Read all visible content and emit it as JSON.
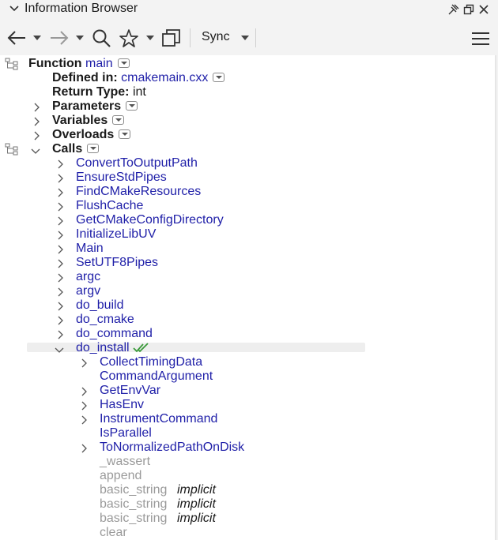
{
  "panel": {
    "title": "Information Browser"
  },
  "toolbar": {
    "sync_label": "Sync"
  },
  "tree": {
    "function_keyword": "Function",
    "function_name": "main",
    "defined_in_label": "Defined in:",
    "defined_in_file": "cmakemain.cxx",
    "return_type_label": "Return Type:",
    "return_type_value": "int",
    "parameters": "Parameters",
    "variables": "Variables",
    "overloads": "Overloads",
    "calls": "Calls",
    "call_items": [
      "ConvertToOutputPath",
      "EnsureStdPipes",
      "FindCMakeResources",
      "FlushCache",
      "GetCMakeConfigDirectory",
      "InitializeLibUV",
      "Main",
      "SetUTF8Pipes",
      "argc",
      "argv",
      "do_build",
      "do_cmake",
      "do_command",
      "do_install"
    ],
    "install_children": [
      "CollectTimingData",
      "CommandArgument",
      "GetEnvVar",
      "HasEnv",
      "InstrumentCommand",
      "IsParallel",
      "ToNormalizedPathOnDisk"
    ],
    "gray_items": [
      "_wassert",
      "append",
      "basic_string",
      "basic_string",
      "basic_string",
      "clear"
    ],
    "implicit_label": "implicit"
  }
}
